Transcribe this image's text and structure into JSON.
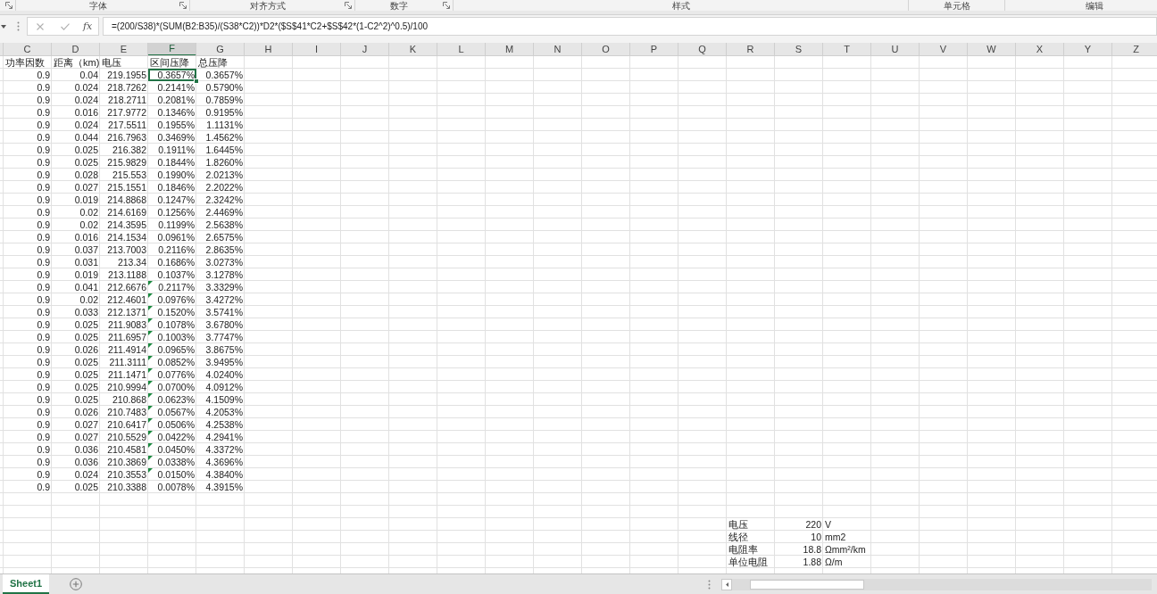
{
  "ribbon": {
    "groups": [
      {
        "launcher": true
      },
      {
        "label": "字体",
        "launcher": true
      },
      {
        "label": "对齐方式",
        "launcher": true
      },
      {
        "label": "数字",
        "launcher": true
      },
      {
        "label": "样式",
        "launcher": false
      },
      {
        "label": "单元格",
        "launcher": false
      },
      {
        "label": "编辑",
        "launcher": false
      }
    ]
  },
  "formula_bar": {
    "function_label": "fx",
    "formula": "=(200/S38)*(SUM(B2:B35)/(S38*C2))*D2*($S$41*C2+$S$42*(1-C2^2)^0.5)/100"
  },
  "table": {
    "columns": [
      {
        "label": "C",
        "selected": false
      },
      {
        "label": "D",
        "selected": false
      },
      {
        "label": "E",
        "selected": false
      },
      {
        "label": "F",
        "selected": true
      },
      {
        "label": "G",
        "selected": false
      },
      {
        "label": "H",
        "selected": false
      },
      {
        "label": "I",
        "selected": false
      },
      {
        "label": "J",
        "selected": false
      },
      {
        "label": "K",
        "selected": false
      },
      {
        "label": "L",
        "selected": false
      },
      {
        "label": "M",
        "selected": false
      },
      {
        "label": "N",
        "selected": false
      },
      {
        "label": "O",
        "selected": false
      },
      {
        "label": "P",
        "selected": false
      },
      {
        "label": "Q",
        "selected": false
      },
      {
        "label": "R",
        "selected": false
      },
      {
        "label": "S",
        "selected": false
      },
      {
        "label": "T",
        "selected": false
      },
      {
        "label": "U",
        "selected": false
      },
      {
        "label": "V",
        "selected": false
      },
      {
        "label": "W",
        "selected": false
      },
      {
        "label": "X",
        "selected": false
      },
      {
        "label": "Y",
        "selected": false
      },
      {
        "label": "Z",
        "selected": false
      }
    ],
    "header": [
      "功率因数",
      "距离（km)",
      "电压",
      "区间压降",
      "总压降"
    ],
    "rows": [
      {
        "cells": [
          "0.9",
          "0.04",
          "219.1955",
          "0.3657%",
          "0.3657%"
        ],
        "selected": true,
        "warning": false
      },
      {
        "cells": [
          "0.9",
          "0.024",
          "218.7262",
          "0.2141%",
          "0.5790%"
        ],
        "selected": false,
        "warning": false
      },
      {
        "cells": [
          "0.9",
          "0.024",
          "218.2711",
          "0.2081%",
          "0.7859%"
        ],
        "selected": false,
        "warning": false
      },
      {
        "cells": [
          "0.9",
          "0.016",
          "217.9772",
          "0.1346%",
          "0.9195%"
        ],
        "selected": false,
        "warning": false
      },
      {
        "cells": [
          "0.9",
          "0.024",
          "217.5511",
          "0.1955%",
          "1.1131%"
        ],
        "selected": false,
        "warning": false
      },
      {
        "cells": [
          "0.9",
          "0.044",
          "216.7963",
          "0.3469%",
          "1.4562%"
        ],
        "selected": false,
        "warning": false
      },
      {
        "cells": [
          "0.9",
          "0.025",
          "216.382",
          "0.1911%",
          "1.6445%"
        ],
        "selected": false,
        "warning": false
      },
      {
        "cells": [
          "0.9",
          "0.025",
          "215.9829",
          "0.1844%",
          "1.8260%"
        ],
        "selected": false,
        "warning": false
      },
      {
        "cells": [
          "0.9",
          "0.028",
          "215.553",
          "0.1990%",
          "2.0213%"
        ],
        "selected": false,
        "warning": false
      },
      {
        "cells": [
          "0.9",
          "0.027",
          "215.1551",
          "0.1846%",
          "2.2022%"
        ],
        "selected": false,
        "warning": false
      },
      {
        "cells": [
          "0.9",
          "0.019",
          "214.8868",
          "0.1247%",
          "2.3242%"
        ],
        "selected": false,
        "warning": false
      },
      {
        "cells": [
          "0.9",
          "0.02",
          "214.6169",
          "0.1256%",
          "2.4469%"
        ],
        "selected": false,
        "warning": false
      },
      {
        "cells": [
          "0.9",
          "0.02",
          "214.3595",
          "0.1199%",
          "2.5638%"
        ],
        "selected": false,
        "warning": false
      },
      {
        "cells": [
          "0.9",
          "0.016",
          "214.1534",
          "0.0961%",
          "2.6575%"
        ],
        "selected": false,
        "warning": false
      },
      {
        "cells": [
          "0.9",
          "0.037",
          "213.7003",
          "0.2116%",
          "2.8635%"
        ],
        "selected": false,
        "warning": false
      },
      {
        "cells": [
          "0.9",
          "0.031",
          "213.34",
          "0.1686%",
          "3.0273%"
        ],
        "selected": false,
        "warning": false
      },
      {
        "cells": [
          "0.9",
          "0.019",
          "213.1188",
          "0.1037%",
          "3.1278%"
        ],
        "selected": false,
        "warning": false
      },
      {
        "cells": [
          "0.9",
          "0.041",
          "212.6676",
          "0.2117%",
          "3.3329%"
        ],
        "selected": false,
        "warning": true
      },
      {
        "cells": [
          "0.9",
          "0.02",
          "212.4601",
          "0.0976%",
          "3.4272%"
        ],
        "selected": false,
        "warning": true
      },
      {
        "cells": [
          "0.9",
          "0.033",
          "212.1371",
          "0.1520%",
          "3.5741%"
        ],
        "selected": false,
        "warning": true
      },
      {
        "cells": [
          "0.9",
          "0.025",
          "211.9083",
          "0.1078%",
          "3.6780%"
        ],
        "selected": false,
        "warning": true
      },
      {
        "cells": [
          "0.9",
          "0.025",
          "211.6957",
          "0.1003%",
          "3.7747%"
        ],
        "selected": false,
        "warning": true
      },
      {
        "cells": [
          "0.9",
          "0.026",
          "211.4914",
          "0.0965%",
          "3.8675%"
        ],
        "selected": false,
        "warning": true
      },
      {
        "cells": [
          "0.9",
          "0.025",
          "211.3111",
          "0.0852%",
          "3.9495%"
        ],
        "selected": false,
        "warning": true
      },
      {
        "cells": [
          "0.9",
          "0.025",
          "211.1471",
          "0.0776%",
          "4.0240%"
        ],
        "selected": false,
        "warning": true
      },
      {
        "cells": [
          "0.9",
          "0.025",
          "210.9994",
          "0.0700%",
          "4.0912%"
        ],
        "selected": false,
        "warning": true
      },
      {
        "cells": [
          "0.9",
          "0.025",
          "210.868",
          "0.0623%",
          "4.1509%"
        ],
        "selected": false,
        "warning": true
      },
      {
        "cells": [
          "0.9",
          "0.026",
          "210.7483",
          "0.0567%",
          "4.2053%"
        ],
        "selected": false,
        "warning": true
      },
      {
        "cells": [
          "0.9",
          "0.027",
          "210.6417",
          "0.0506%",
          "4.2538%"
        ],
        "selected": false,
        "warning": true
      },
      {
        "cells": [
          "0.9",
          "0.027",
          "210.5529",
          "0.0422%",
          "4.2941%"
        ],
        "selected": false,
        "warning": true
      },
      {
        "cells": [
          "0.9",
          "0.036",
          "210.4581",
          "0.0450%",
          "4.3372%"
        ],
        "selected": false,
        "warning": true
      },
      {
        "cells": [
          "0.9",
          "0.036",
          "210.3869",
          "0.0338%",
          "4.3696%"
        ],
        "selected": false,
        "warning": true
      },
      {
        "cells": [
          "0.9",
          "0.024",
          "210.3553",
          "0.0150%",
          "4.3840%"
        ],
        "selected": false,
        "warning": true
      },
      {
        "cells": [
          "0.9",
          "0.025",
          "210.3388",
          "0.0078%",
          "4.3915%"
        ],
        "selected": false,
        "warning": false
      }
    ],
    "parameters": [
      {
        "label": "电压",
        "value": "220",
        "unit": "V"
      },
      {
        "label": "线径",
        "value": "10",
        "unit": "mm2"
      },
      {
        "label": "电阻率",
        "value": "18.8",
        "unit": "Ωmm²/km"
      },
      {
        "label": "单位电阻",
        "value": "1.88",
        "unit": "Ω/m"
      }
    ]
  },
  "sheet_tabs": [
    {
      "label": "Sheet1",
      "selected": true
    }
  ]
}
